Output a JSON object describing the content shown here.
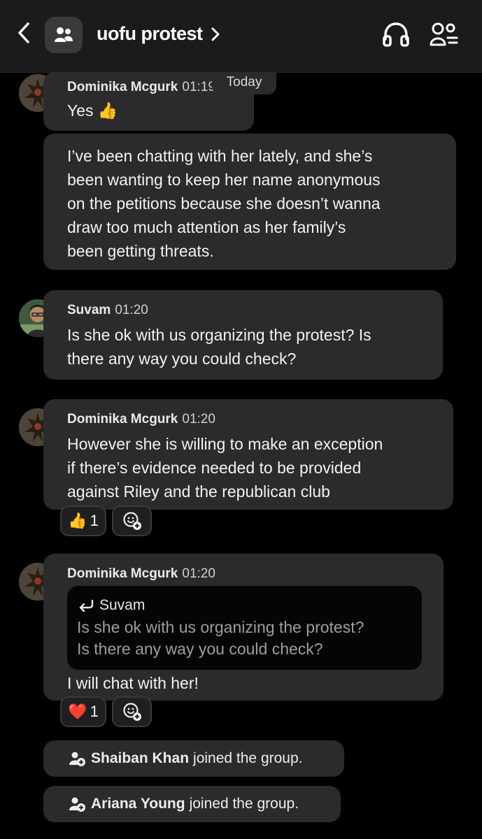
{
  "header": {
    "title": "uofu protest"
  },
  "divider": {
    "today_label": "Today"
  },
  "messages": [
    {
      "author": "Dominika Mcgurk",
      "time": "01:19",
      "text": "Yes 👍"
    },
    {
      "text": "I’ve been chatting with her lately, and she’s\nbeen wanting to keep her name anonymous\non the petitions because she doesn’t wanna\ndraw too much attention as her family’s\nbeen getting threats."
    },
    {
      "author": "Suvam",
      "time": "01:20",
      "text": "Is she ok with us organizing the protest? Is\nthere any way you could check?"
    },
    {
      "author": "Dominika Mcgurk",
      "time": "01:20",
      "text": "However she is willing to make an exception\nif there’s evidence needed to be provided\nagainst Riley and the republican club",
      "reaction": {
        "emoji": "👍",
        "count": "1"
      }
    },
    {
      "author": "Dominika Mcgurk",
      "time": "01:20",
      "reply": {
        "author": "Suvam",
        "text": "Is she ok with us organizing the protest?\nIs there any way you could check?"
      },
      "text": "I will chat with her!",
      "reaction": {
        "emoji": "❤️",
        "count": "1"
      }
    }
  ],
  "system": [
    {
      "name": "Shaiban Khan",
      "text": "joined the group."
    },
    {
      "name": "Ariana Young",
      "text": "joined the group."
    }
  ],
  "icons": {
    "back": "chevron-left-icon",
    "group": "group-icon",
    "chevron": "chevron-right-icon",
    "audio": "headphones-icon",
    "members": "members-icon",
    "add_reaction": "add-reaction-icon",
    "join": "person-add-icon",
    "reply": "reply-arrow-icon"
  }
}
